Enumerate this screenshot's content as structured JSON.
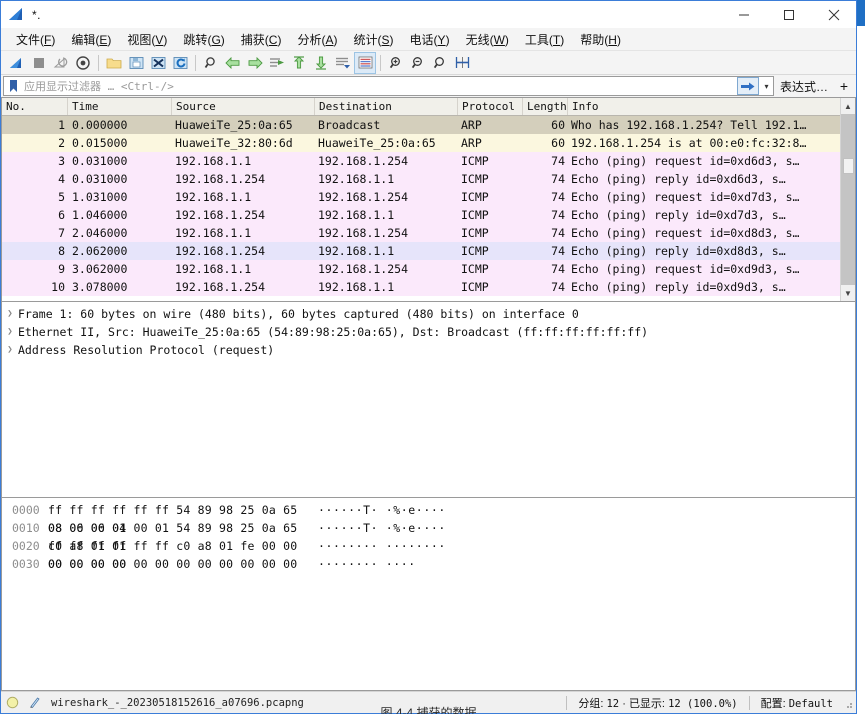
{
  "window": {
    "title": "*.",
    "app_icon": "wireshark-shark-fin-icon",
    "controls": {
      "minimize": "minimize-icon",
      "maximize": "maximize-icon",
      "close": "close-icon"
    }
  },
  "menubar": [
    {
      "label": "文件",
      "mnemonic": "F"
    },
    {
      "label": "编辑",
      "mnemonic": "E"
    },
    {
      "label": "视图",
      "mnemonic": "V"
    },
    {
      "label": "跳转",
      "mnemonic": "G"
    },
    {
      "label": "捕获",
      "mnemonic": "C"
    },
    {
      "label": "分析",
      "mnemonic": "A"
    },
    {
      "label": "统计",
      "mnemonic": "S"
    },
    {
      "label": "电话",
      "mnemonic": "Y"
    },
    {
      "label": "无线",
      "mnemonic": "W"
    },
    {
      "label": "工具",
      "mnemonic": "T"
    },
    {
      "label": "帮助",
      "mnemonic": "H"
    }
  ],
  "toolbar": {
    "buttons": [
      "start-capture-icon",
      "stop-capture-icon",
      "restart-capture-icon",
      "capture-options-icon",
      "open-file-icon",
      "save-file-icon",
      "close-file-icon",
      "reload-file-icon",
      "find-packet-icon",
      "go-back-icon",
      "go-forward-icon",
      "go-to-packet-icon",
      "go-first-packet-icon",
      "go-last-packet-icon",
      "auto-scroll-icon",
      "colorize-packets-icon",
      "zoom-in-icon",
      "zoom-out-icon",
      "zoom-reset-icon",
      "resize-columns-icon"
    ],
    "selected_index": 15
  },
  "filterbar": {
    "bookmark_icon": "filter-bookmark-icon",
    "placeholder": "应用显示过滤器 … <Ctrl-/>",
    "value": "",
    "apply_icon": "apply-filter-arrow-icon",
    "dropdown_icon": "chevron-down-icon",
    "expression_label": "表达式…",
    "add_label": "+"
  },
  "packet_list": {
    "columns": [
      "No.",
      "Time",
      "Source",
      "Destination",
      "Protocol",
      "Length",
      "Info"
    ],
    "rows": [
      {
        "no": "1",
        "time": "0.000000",
        "source": "HuaweiTe_25:0a:65",
        "destination": "Broadcast",
        "protocol": "ARP",
        "length": "60",
        "info": "Who has 192.168.1.254? Tell 192.1…",
        "style": "arp-selected"
      },
      {
        "no": "2",
        "time": "0.015000",
        "source": "HuaweiTe_32:80:6d",
        "destination": "HuaweiTe_25:0a:65",
        "protocol": "ARP",
        "length": "60",
        "info": "192.168.1.254 is at 00:e0:fc:32:8…",
        "style": "arp"
      },
      {
        "no": "3",
        "time": "0.031000",
        "source": "192.168.1.1",
        "destination": "192.168.1.254",
        "protocol": "ICMP",
        "length": "74",
        "info": "Echo (ping) request   id=0xd6d3, s…",
        "style": "icmp"
      },
      {
        "no": "4",
        "time": "0.031000",
        "source": "192.168.1.254",
        "destination": "192.168.1.1",
        "protocol": "ICMP",
        "length": "74",
        "info": "Echo (ping) reply     id=0xd6d3, s…",
        "style": "icmp"
      },
      {
        "no": "5",
        "time": "1.031000",
        "source": "192.168.1.1",
        "destination": "192.168.1.254",
        "protocol": "ICMP",
        "length": "74",
        "info": "Echo (ping) request   id=0xd7d3, s…",
        "style": "icmp"
      },
      {
        "no": "6",
        "time": "1.046000",
        "source": "192.168.1.254",
        "destination": "192.168.1.1",
        "protocol": "ICMP",
        "length": "74",
        "info": "Echo (ping) reply     id=0xd7d3, s…",
        "style": "icmp"
      },
      {
        "no": "7",
        "time": "2.046000",
        "source": "192.168.1.1",
        "destination": "192.168.1.254",
        "protocol": "ICMP",
        "length": "74",
        "info": "Echo (ping) request   id=0xd8d3, s…",
        "style": "icmp"
      },
      {
        "no": "8",
        "time": "2.062000",
        "source": "192.168.1.254",
        "destination": "192.168.1.1",
        "protocol": "ICMP",
        "length": "74",
        "info": "Echo (ping) reply     id=0xd8d3, s…",
        "style": "icmp-alt"
      },
      {
        "no": "9",
        "time": "3.062000",
        "source": "192.168.1.1",
        "destination": "192.168.1.254",
        "protocol": "ICMP",
        "length": "74",
        "info": "Echo (ping) request   id=0xd9d3, s…",
        "style": "icmp"
      },
      {
        "no": "10",
        "time": "3.078000",
        "source": "192.168.1.254",
        "destination": "192.168.1.1",
        "protocol": "ICMP",
        "length": "74",
        "info": "Echo (ping) reply     id=0xd9d3, s…",
        "style": "icmp"
      }
    ],
    "scrollbar": {
      "up_icon": "chevron-up-icon",
      "down_icon": "chevron-down-icon"
    }
  },
  "detail_pane": {
    "rows": [
      {
        "arrow": "expand-triangle-icon",
        "text": "Frame 1: 60 bytes on wire (480 bits), 60 bytes captured (480 bits) on interface 0"
      },
      {
        "arrow": "expand-triangle-icon",
        "text": "Ethernet II, Src: HuaweiTe_25:0a:65 (54:89:98:25:0a:65), Dst: Broadcast (ff:ff:ff:ff:ff:ff)"
      },
      {
        "arrow": "expand-triangle-icon",
        "text": "Address Resolution Protocol (request)"
      }
    ]
  },
  "bytes_pane": {
    "rows": [
      {
        "offset": "0000",
        "hex": "ff ff ff ff ff ff 54 89  98 25 0a 65 08 06 00 01",
        "ascii": "······T· ·%·e····"
      },
      {
        "offset": "0010",
        "hex": "08 00 06 04 00 01 54 89  98 25 0a 65 c0 a8 01 01",
        "ascii": "······T· ·%·e····"
      },
      {
        "offset": "0020",
        "hex": "ff ff ff ff ff ff c0 a8  01 fe 00 00 00 00 00 00",
        "ascii": "········ ········"
      },
      {
        "offset": "0030",
        "hex": "00 00 00 00 00 00 00 00  00 00 00 00",
        "ascii": "········ ····"
      }
    ]
  },
  "statusbar": {
    "expert_icon": "expert-info-circle-icon",
    "annotation_icon": "capture-comment-icon",
    "file_name": "wireshark_-_20230518152616_a07696.pcapng",
    "packets_label": "分组:",
    "packets_value": "12",
    "dot": "·",
    "displayed_label": "已显示:",
    "displayed_value": "12 (100.0%)",
    "profile_label": "配置:",
    "profile_value": "Default"
  },
  "caption": "图 4-4 捕获的数据",
  "colors": {
    "arp_selected_bg": "#d4cfbc",
    "arp_bg": "#fbf7df",
    "icmp_bg": "#fbe9fb",
    "icmp_alt_bg": "#e6e4fa",
    "accent": "#3b7dd8",
    "header_bg": "#f1f0ea"
  }
}
